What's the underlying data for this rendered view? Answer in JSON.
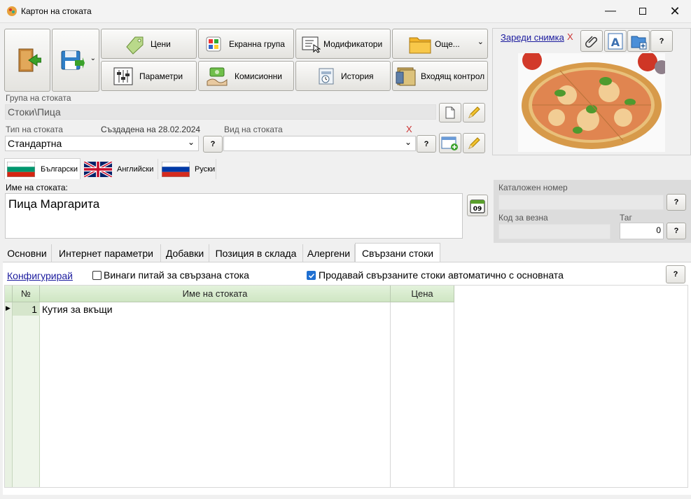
{
  "window": {
    "title": "Картон на стоката"
  },
  "toolbar": {
    "prices": "Цени",
    "screen_group": "Екранна група",
    "modifiers": "Модификатори",
    "more": "Още...",
    "params": "Параметри",
    "commission": "Комисионни",
    "history": "История",
    "incoming_control": "Входящ контрол"
  },
  "image_panel": {
    "load_photo": "Зареди снимка",
    "clear": "X",
    "help": "?"
  },
  "group": {
    "label": "Група на стоката",
    "value": "Стоки\\Пица"
  },
  "type": {
    "label": "Тип на стоката",
    "value": "Стандартна",
    "help": "?"
  },
  "created": {
    "label": "Създадена на 28.02.2024"
  },
  "kind": {
    "label": "Вид на стоката",
    "value": "",
    "clear": "X",
    "help": "?"
  },
  "languages": [
    {
      "name": "Български"
    },
    {
      "name": "Английски"
    },
    {
      "name": "Руски"
    }
  ],
  "name": {
    "label": "Име на стоката:",
    "value": "Пица Маргарита",
    "calendar_day": "09"
  },
  "catalog": {
    "label": "Каталожен номер",
    "value": "",
    "help": "?"
  },
  "scale_code": {
    "label": "Код за везна",
    "value": ""
  },
  "tag": {
    "label": "Таг",
    "value": "0",
    "help": "?"
  },
  "tabs": [
    "Основни",
    "Интернет параметри",
    "Добавки",
    "Позиция в склада",
    "Алергени",
    "Свързани стоки"
  ],
  "related": {
    "configure": "Конфигурирай",
    "always_ask": "Винаги питай за свързана стока",
    "always_ask_checked": false,
    "sell_auto": "Продавай свързаните стоки автоматично с основната",
    "sell_auto_checked": true,
    "help": "?"
  },
  "grid": {
    "columns": [
      "№",
      "Име на стоката",
      "Цена"
    ],
    "rows": [
      {
        "no": "1",
        "name": "Кутия за вкъщи",
        "price": ""
      }
    ]
  },
  "colors": {
    "grid_header": "#d6ead0",
    "link": "#1b1b9e",
    "checkbox": "#1f6fd1",
    "flag_bg_green": "#009b3a"
  }
}
